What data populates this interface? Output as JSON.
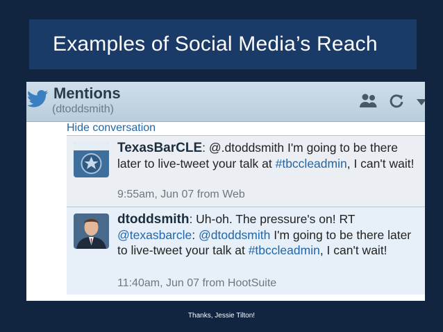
{
  "slide": {
    "title": "Examples of Social Media’s Reach",
    "caption": "Thanks, Jessie Tilton!"
  },
  "panel": {
    "title": "Mentions",
    "username": "(dtoddsmith)",
    "hide_conversation": "Hide conversation",
    "icons": [
      "twitter-bird-icon",
      "people-icon",
      "refresh-icon",
      "dropdown-arrow-icon"
    ]
  },
  "tweets": [
    {
      "user": "TexasBarCLE",
      "avatar_label": "TexasBarCLE",
      "text_parts": [
        ": @.dtoddsmith I'm going to be there later to live-tweet your talk at ",
        "#tbccleadmin",
        ", I can't wait!"
      ],
      "meta": "9:55am, Jun 07 from Web"
    },
    {
      "user": "dtoddsmith",
      "text_parts": [
        ": Uh-oh. The pressure's on! RT ",
        "@texasbarcle",
        ": ",
        "@dtoddsmith",
        " I'm going to be there later to live-tweet your talk at ",
        "#tbccleadmin",
        ", I can't wait!"
      ],
      "meta": "11:40am, Jun 07 from HootSuite"
    }
  ],
  "colors": {
    "background": "#112440",
    "title_bar": "#1a3a68",
    "link": "#2266a8"
  }
}
